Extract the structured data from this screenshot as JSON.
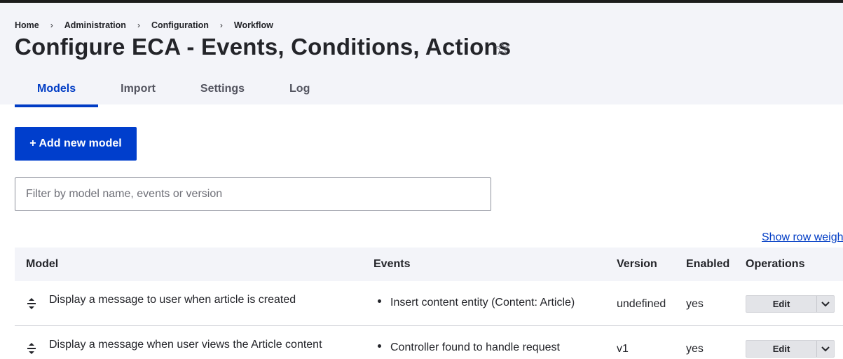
{
  "breadcrumb": [
    "Home",
    "Administration",
    "Configuration",
    "Workflow"
  ],
  "breadcrumb_separator": "›",
  "page_title": "Configure ECA - Events, Conditions, Actions",
  "tabs": [
    {
      "label": "Models",
      "active": true
    },
    {
      "label": "Import",
      "active": false
    },
    {
      "label": "Settings",
      "active": false
    },
    {
      "label": "Log",
      "active": false
    }
  ],
  "add_button_label": "+ Add new model",
  "filter": {
    "placeholder": "Filter by model name, events or version",
    "value": ""
  },
  "show_row_weights_label": "Show row weigh",
  "table": {
    "headers": {
      "model": "Model",
      "events": "Events",
      "version": "Version",
      "enabled": "Enabled",
      "operations": "Operations"
    },
    "rows": [
      {
        "model": "Display a message to user when article is created",
        "event": "Insert content entity (Content: Article)",
        "version": "undefined",
        "enabled": "yes",
        "operation": "Edit"
      },
      {
        "model": "Display a message when user views the Article content",
        "event": "Controller found to handle request",
        "version": "v1",
        "enabled": "yes",
        "operation": "Edit"
      }
    ]
  },
  "colors": {
    "accent": "#003ecc",
    "header_bg": "#f3f4f9",
    "link": "#003cc5"
  }
}
